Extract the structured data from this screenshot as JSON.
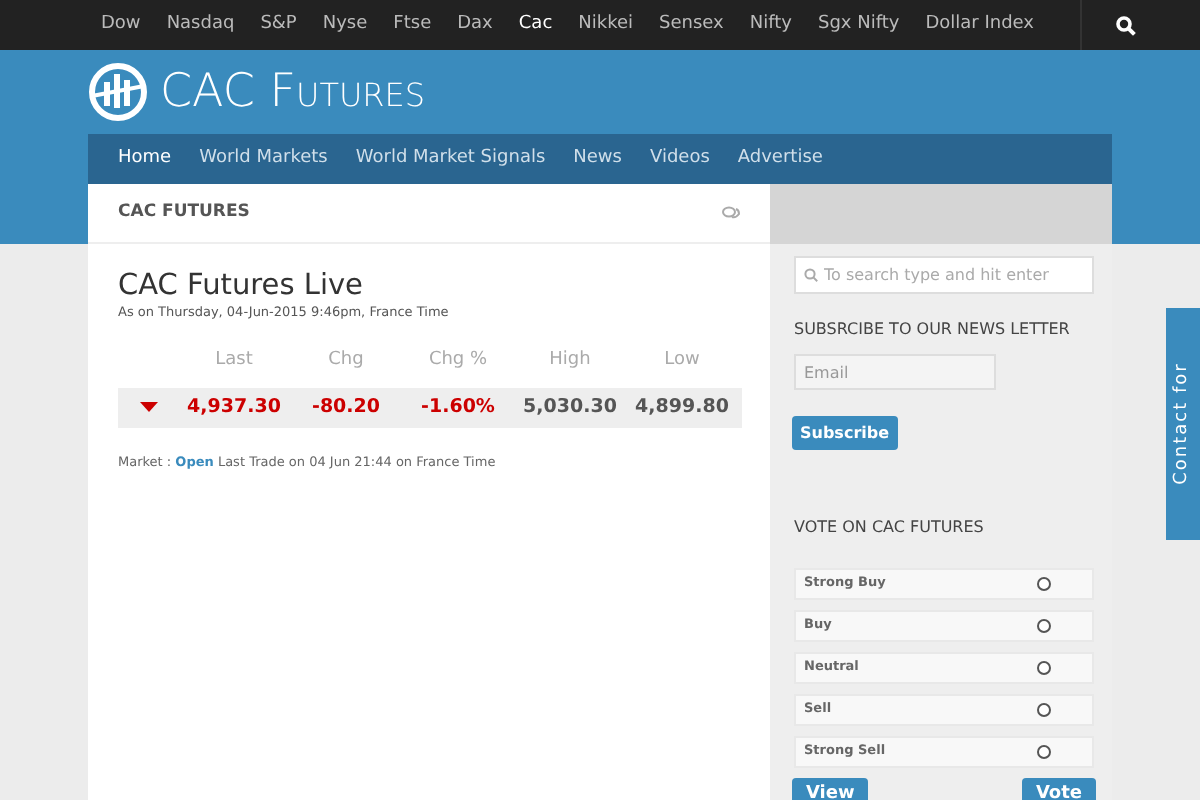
{
  "top_nav": [
    {
      "label": "Dow",
      "selected": false
    },
    {
      "label": "Nasdaq",
      "selected": false
    },
    {
      "label": "S&P",
      "selected": false
    },
    {
      "label": "Nyse",
      "selected": false
    },
    {
      "label": "Ftse",
      "selected": false
    },
    {
      "label": "Dax",
      "selected": false
    },
    {
      "label": "Cac",
      "selected": true
    },
    {
      "label": "Nikkei",
      "selected": false
    },
    {
      "label": "Sensex",
      "selected": false
    },
    {
      "label": "Nifty",
      "selected": false
    },
    {
      "label": "Sgx Nifty",
      "selected": false
    },
    {
      "label": "Dollar Index",
      "selected": false
    }
  ],
  "site_title": "CAC Futures",
  "main_nav": [
    {
      "label": "Home",
      "selected": true
    },
    {
      "label": "World Markets",
      "selected": false
    },
    {
      "label": "World Market Signals",
      "selected": false
    },
    {
      "label": "News",
      "selected": false
    },
    {
      "label": "Videos",
      "selected": false
    },
    {
      "label": "Advertise",
      "selected": false
    }
  ],
  "panel": {
    "title": "CAC FUTURES"
  },
  "quote": {
    "title": "CAC Futures Live",
    "timestamp": "As on Thursday, 04-Jun-2015 9:46pm, France Time",
    "falling": true,
    "columns": [
      "Last",
      "Chg",
      "Chg %",
      "High",
      "Low"
    ],
    "values": [
      {
        "text": "4,937.30",
        "kind": "change"
      },
      {
        "text": "-80.20",
        "kind": "change"
      },
      {
        "text": "-1.60%",
        "kind": "change"
      },
      {
        "text": "5,030.30",
        "kind": "plain"
      },
      {
        "text": "4,899.80",
        "kind": "plain"
      }
    ],
    "market_label": "Market :",
    "market_status": "Open",
    "last_trade": "Last Trade on 04 Jun 21:44 on France Time"
  },
  "sidebar": {
    "search": {
      "placeholder": "To search type and hit enter"
    },
    "newsletter_heading": "SUBSRCIBE TO OUR NEWS LETTER",
    "email": {
      "placeholder": "Email"
    },
    "subscribe_button": "Subscribe",
    "vote_heading": "VOTE ON CAC FUTURES",
    "vote_options": [
      {
        "label": "Strong Buy",
        "selected": false
      },
      {
        "label": "Buy",
        "selected": false
      },
      {
        "label": "Neutral",
        "selected": false
      },
      {
        "label": "Sell",
        "selected": false
      },
      {
        "label": "Strong Sell",
        "selected": false
      }
    ],
    "buttons": [
      "View",
      "Vote"
    ]
  },
  "contact_tab": "Contact for"
}
